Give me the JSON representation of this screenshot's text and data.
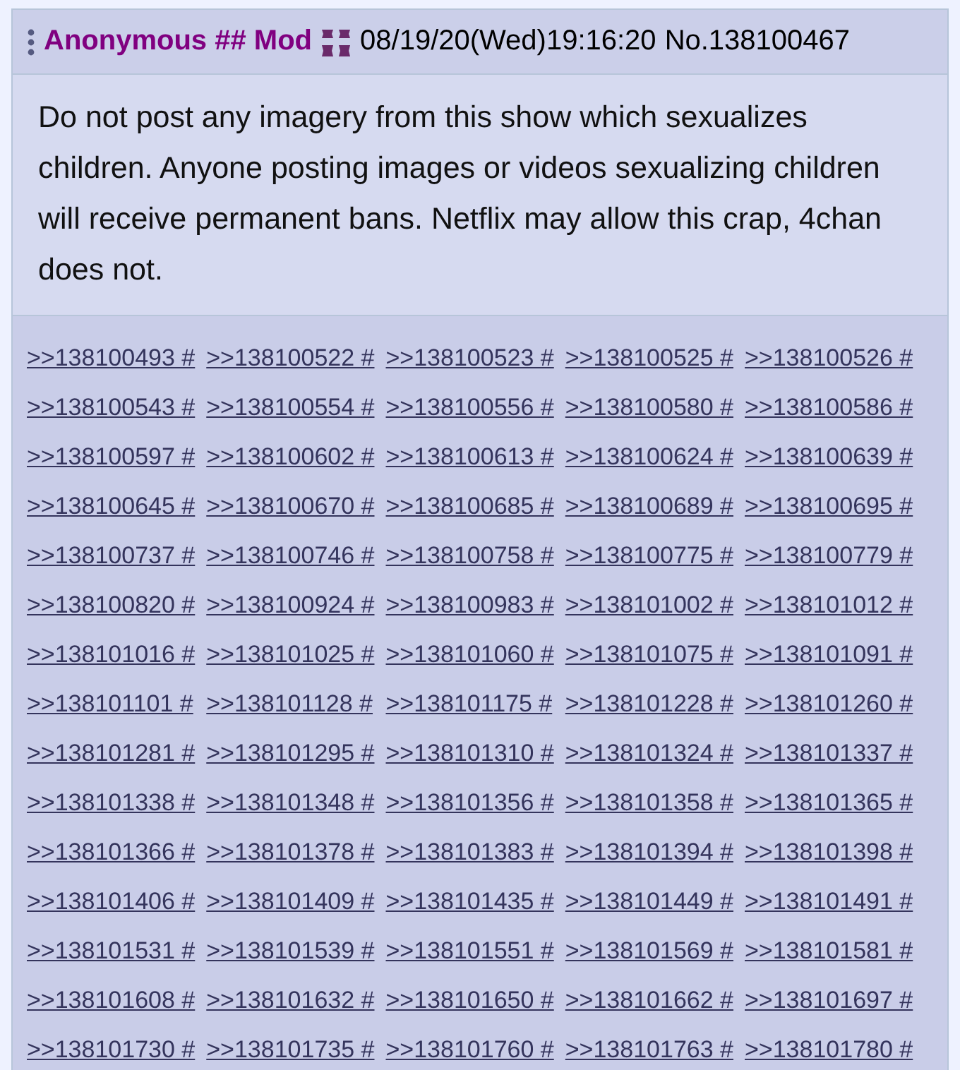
{
  "post": {
    "name": "Anonymous ## Mod",
    "date": "08/19/20(Wed)19:16:20",
    "number": "No.138100467",
    "message": "Do not post any imagery from this show which sexualizes children. Anyone posting images or videos sexualizing children will receive permanent bans. Netflix may allow this crap, 4chan does not.",
    "replies": [
      ">>138100493 #",
      ">>138100522 #",
      ">>138100523 #",
      ">>138100525 #",
      ">>138100526 #",
      ">>138100543 #",
      ">>138100554 #",
      ">>138100556 #",
      ">>138100580 #",
      ">>138100586 #",
      ">>138100597 #",
      ">>138100602 #",
      ">>138100613 #",
      ">>138100624 #",
      ">>138100639 #",
      ">>138100645 #",
      ">>138100670 #",
      ">>138100685 #",
      ">>138100689 #",
      ">>138100695 #",
      ">>138100737 #",
      ">>138100746 #",
      ">>138100758 #",
      ">>138100775 #",
      ">>138100779 #",
      ">>138100820 #",
      ">>138100924 #",
      ">>138100983 #",
      ">>138101002 #",
      ">>138101012 #",
      ">>138101016 #",
      ">>138101025 #",
      ">>138101060 #",
      ">>138101075 #",
      ">>138101091 #",
      ">>138101101 #",
      ">>138101128 #",
      ">>138101175 #",
      ">>138101228 #",
      ">>138101260 #",
      ">>138101281 #",
      ">>138101295 #",
      ">>138101310 #",
      ">>138101324 #",
      ">>138101337 #",
      ">>138101338 #",
      ">>138101348 #",
      ">>138101356 #",
      ">>138101358 #",
      ">>138101365 #",
      ">>138101366 #",
      ">>138101378 #",
      ">>138101383 #",
      ">>138101394 #",
      ">>138101398 #",
      ">>138101406 #",
      ">>138101409 #",
      ">>138101435 #",
      ">>138101449 #",
      ">>138101491 #",
      ">>138101531 #",
      ">>138101539 #",
      ">>138101551 #",
      ">>138101569 #",
      ">>138101581 #",
      ">>138101608 #",
      ">>138101632 #",
      ">>138101650 #",
      ">>138101662 #",
      ">>138101697 #",
      ">>138101730 #",
      ">>138101735 #",
      ">>138101760 #",
      ">>138101763 #",
      ">>138101780 #"
    ]
  }
}
